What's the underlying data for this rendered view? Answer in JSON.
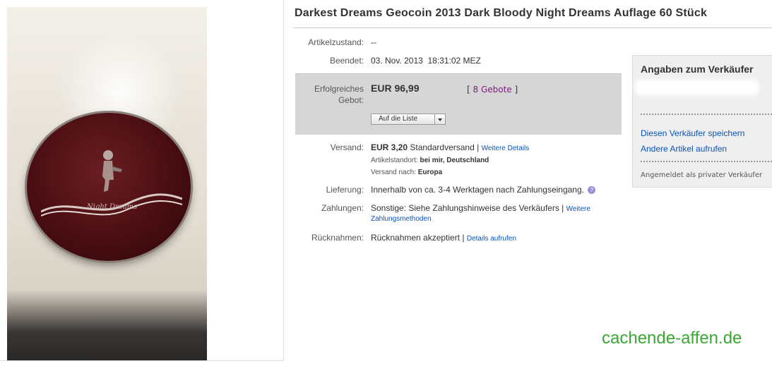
{
  "listing": {
    "title": "Darkest Dreams Geocoin 2013 Dark Bloody Night Dreams Auflage 60 Stück",
    "coin_text": "Night Dreams"
  },
  "details": {
    "condition_label": "Artikelzustand:",
    "condition_value": "--",
    "ended_label": "Beendet:",
    "ended_value": "03. Nov. 2013  18:31:02 MEZ",
    "bid_label_1": "Erfolgreiches",
    "bid_label_2": "Gebot:",
    "price": "EUR 96,99",
    "bids_open": "[ ",
    "bids_link": "8 Gebote",
    "bids_close": " ]",
    "watch_button": "Auf die Liste",
    "shipping_label": "Versand:",
    "shipping_price": "EUR 3,20",
    "shipping_method": "Standardversand |",
    "shipping_details_link": "Weitere Details",
    "location_label": "Artikelstandort:",
    "location_value": "bei mir, Deutschland",
    "ship_to_label": "Versand nach:",
    "ship_to_value": "Europa",
    "delivery_label": "Lieferung:",
    "delivery_value": "Innerhalb von ca. 3-4 Werktagen nach Zahlungseingang.",
    "payment_label": "Zahlungen:",
    "payment_value": "Sonstige: Siehe Zahlungshinweise des Verkäufers  |",
    "payment_link_1": "Weitere",
    "payment_link_2": "Zahlungsmethoden",
    "returns_label": "Rücknahmen:",
    "returns_value": "Rücknahmen akzeptiert |",
    "returns_link": "Details aufrufen"
  },
  "seller": {
    "title": "Angaben zum Verkäufer",
    "save_link": "Diesen Verkäufer speichern",
    "other_items_link": "Andere Artikel aufrufen",
    "note": "Angemeldet als privater Verkäufer"
  },
  "watermark": "cachende-affen.de",
  "colors": {
    "link": "#0654ba",
    "bids_link": "#7b1b7b",
    "watermark": "#3aa832",
    "bid_box": "#d6d6d6"
  }
}
